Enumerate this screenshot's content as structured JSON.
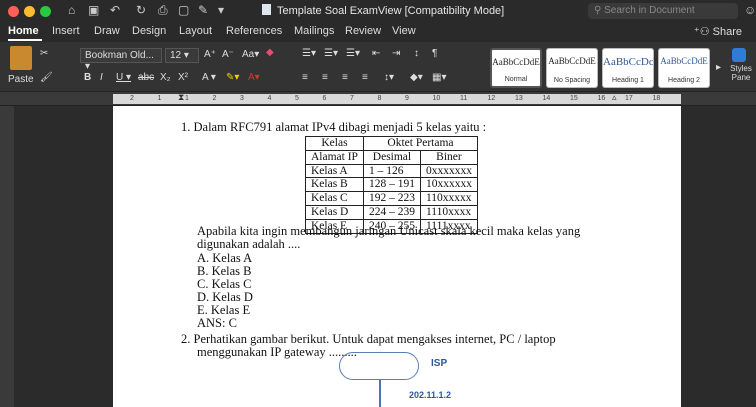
{
  "window": {
    "title": "Template Soal ExamView [Compatibility Mode]",
    "search_placeholder": "Search in Document"
  },
  "tabs": [
    "Home",
    "Insert",
    "Draw",
    "Design",
    "Layout",
    "References",
    "Mailings",
    "Review",
    "View"
  ],
  "share_label": "Share",
  "ribbon": {
    "paste_label": "Paste",
    "font_name": "Bookman Old...",
    "font_size": "12",
    "styles": [
      {
        "sample": "AaBbCcDdE",
        "name": "Normal"
      },
      {
        "sample": "AaBbCcDdE",
        "name": "No Spacing"
      },
      {
        "sample": "AaBbCcDc",
        "name": "Heading 1"
      },
      {
        "sample": "AaBbCcDdE",
        "name": "Heading 2"
      }
    ],
    "styles_pane_label": "Styles Pane"
  },
  "ruler_numbers": [
    "2",
    "1",
    "1",
    "2",
    "3",
    "4",
    "5",
    "6",
    "7",
    "8",
    "9",
    "10",
    "11",
    "12",
    "13",
    "14",
    "15",
    "16",
    "17",
    "18"
  ],
  "document": {
    "q1": {
      "stem": "1.  Dalam RFC791 alamat IPv4 dibagi menjadi 5 kelas yaitu :",
      "table": {
        "header1": [
          "Kelas",
          "Oktet Pertama"
        ],
        "header2": [
          "Alamat IP",
          "Desimal",
          "Biner"
        ],
        "rows": [
          [
            "Kelas A",
            "1 – 126",
            "0xxxxxxx"
          ],
          [
            "Kelas B",
            "128 – 191",
            "10xxxxxx"
          ],
          [
            "Kelas C",
            "192 – 223",
            "110xxxxx"
          ],
          [
            "Kelas D",
            "224 – 239",
            "1110xxxx"
          ],
          [
            "Kelas E",
            "240 – 255",
            "1111xxxx"
          ]
        ]
      },
      "follow_line1": "Apabila kita ingin membangun jaringan Unicast skala kecil maka kelas yang",
      "follow_line2": "digunakan adalah ....",
      "options": [
        "A.  Kelas A",
        "B.  Kelas B",
        "C.  Kelas C",
        "D.  Kelas D",
        "E.  Kelas E"
      ],
      "answer": "ANS: C"
    },
    "q2": {
      "line1": "2.  Perhatikan gambar berikut. Untuk dapat mengakses internet, PC / laptop",
      "line2": "menggunakan IP gateway ........."
    },
    "diagram": {
      "isp_label": "ISP",
      "ip_label": "202.11.1.2"
    }
  }
}
